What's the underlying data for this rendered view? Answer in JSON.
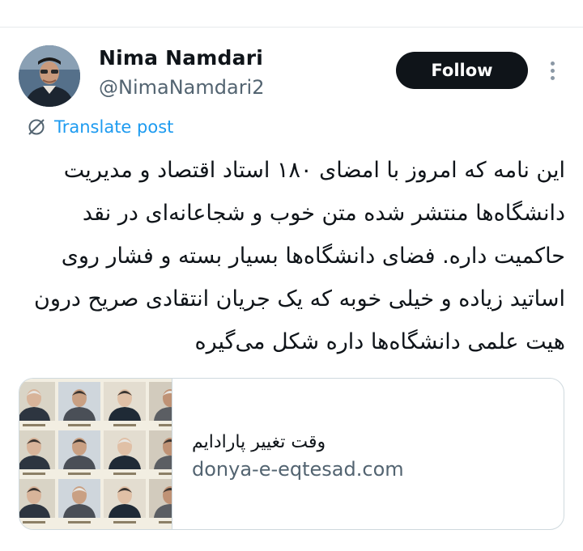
{
  "author": {
    "display_name": "Nima Namdari",
    "handle": "@NimaNamdari2",
    "avatar_icon": "profile-photo"
  },
  "actions": {
    "follow_label": "Follow",
    "more_icon": "more-vertical-icon"
  },
  "translate": {
    "label": "Translate post",
    "icon": "translate-icon"
  },
  "post": {
    "text": "این نامه که امروز با امضای ۱۸۰ استاد اقتصاد و مدیریت دانشگاه‌ها منتشر شده متن خوب و شجاعانه‌ای در نقد حاکمیت داره. فضای دانشگاه‌ها بسیار بسته و فشار روی اساتید زیاده و خیلی خوبه که یک جریان انتقادی صریح درون هیت علمی دانشگاه‌ها داره شکل می‌گیره"
  },
  "link_card": {
    "title": "وقت تغییر پارادایم",
    "domain": "donya-e-eqtesad.com",
    "thumbnail": "grid-of-portrait-photos"
  },
  "colors": {
    "text": "#0f1419",
    "secondary_text": "#536471",
    "link_blue": "#1d9bf0",
    "follow_bg": "#0f1419",
    "border": "#cfd9de"
  }
}
